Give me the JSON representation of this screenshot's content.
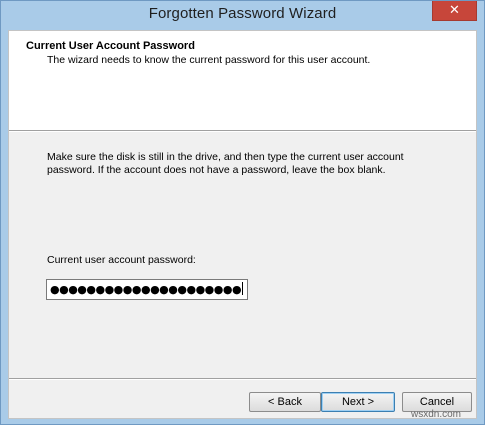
{
  "window": {
    "title": "Forgotten Password Wizard",
    "close_label": "✕"
  },
  "header": {
    "title": "Current User Account Password",
    "subtitle": "The wizard needs to know the current password for this user account."
  },
  "body": {
    "instructions": "Make sure the disk is still in the drive, and then type the current user account password. If the account does not have a password, leave the box blank.",
    "password_label": "Current user account password:",
    "password_value": "●●●●●●●●●●●●●●●●●●●●●"
  },
  "buttons": {
    "back": "< Back",
    "next": "Next >",
    "cancel": "Cancel"
  },
  "watermark": "wsxdn.com",
  "colors": {
    "titlebar": "#a9cbe8",
    "close": "#c7463a",
    "panel": "#f0f0f0"
  }
}
